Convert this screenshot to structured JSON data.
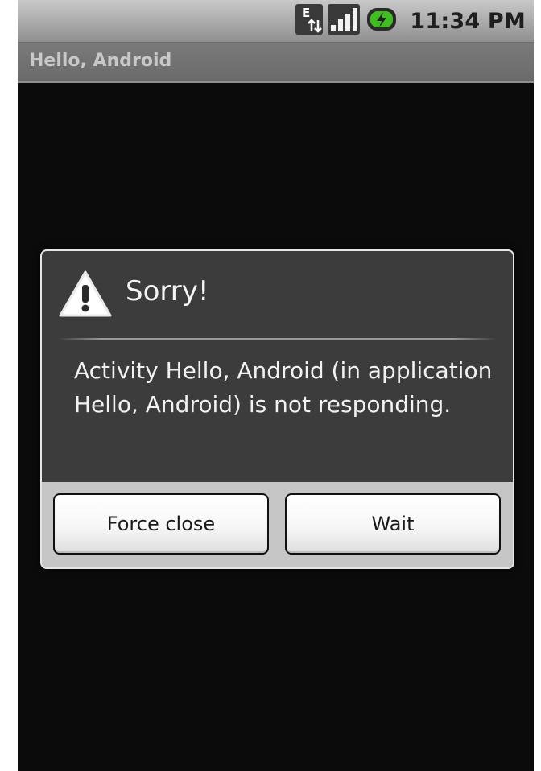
{
  "status_bar": {
    "time": "11:34 PM",
    "icons": [
      "edge-data-icon",
      "signal-icon",
      "battery-charging-icon"
    ],
    "edge_label": "E"
  },
  "app": {
    "title": "Hello, Android"
  },
  "dialog": {
    "title": "Sorry!",
    "icon": "warning-icon",
    "message": "Activity Hello, Android (in application Hello, Android) is not responding.",
    "buttons": {
      "force_close": "Force close",
      "wait": "Wait"
    }
  },
  "colors": {
    "screen_bg": "#0b0b0b",
    "dialog_bg": "#3c3c3c",
    "button_bar_bg": "#c6c6c6",
    "battery_green": "#3fbf1f"
  }
}
